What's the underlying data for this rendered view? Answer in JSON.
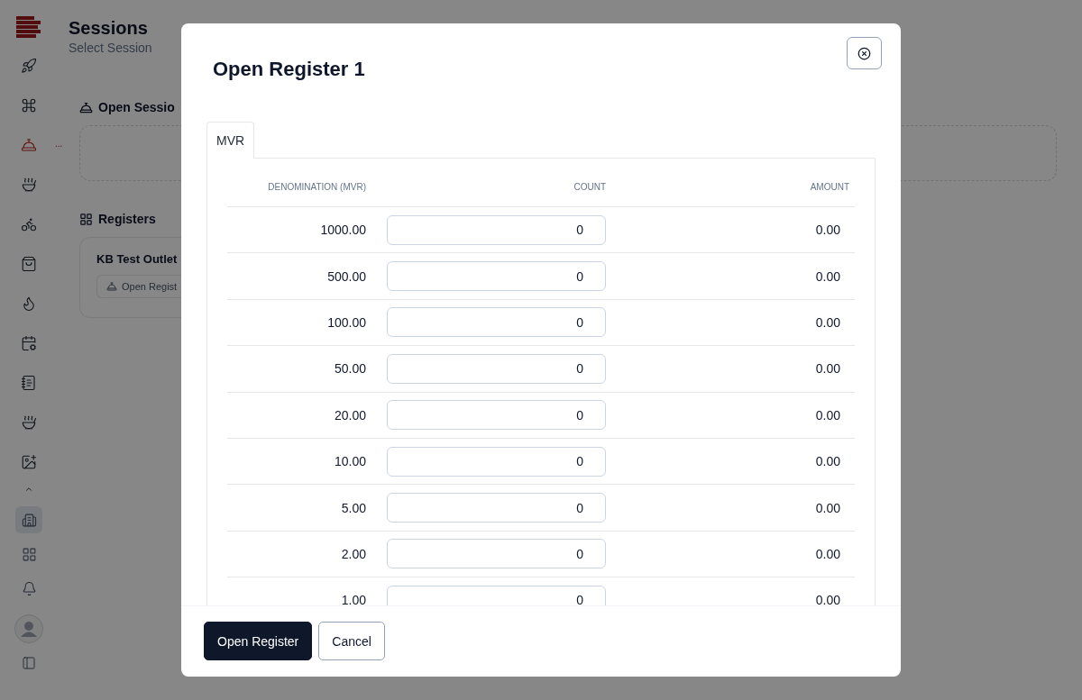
{
  "page": {
    "title": "Sessions",
    "subtitle": "Select Session"
  },
  "sidebar": {
    "nav": [
      {
        "selected": false
      },
      {
        "selected": false
      },
      {
        "selected": true,
        "badge": "..."
      },
      {
        "selected": false
      },
      {
        "selected": false
      },
      {
        "selected": false
      },
      {
        "selected": false
      },
      {
        "selected": false
      },
      {
        "selected": false
      },
      {
        "selected": false
      },
      {
        "selected": false
      }
    ],
    "bottom": [
      {
        "selected": true
      },
      {
        "selected": false
      },
      {
        "selected": false
      }
    ]
  },
  "open_sessions": {
    "heading": "Open Sessio"
  },
  "registers": {
    "heading": "Registers",
    "cards": [
      {
        "name": "KB Test Outlet",
        "button": "Open Regist"
      }
    ]
  },
  "modal": {
    "title": "Open Register 1",
    "tabs": [
      {
        "label": "MVR",
        "selected": true
      }
    ],
    "columns": [
      "DENOMINATION (MVR)",
      "COUNT",
      "AMOUNT"
    ],
    "rows": [
      {
        "denomination": "1000.00",
        "count": "0",
        "amount": "0.00"
      },
      {
        "denomination": "500.00",
        "count": "0",
        "amount": "0.00"
      },
      {
        "denomination": "100.00",
        "count": "0",
        "amount": "0.00"
      },
      {
        "denomination": "50.00",
        "count": "0",
        "amount": "0.00"
      },
      {
        "denomination": "20.00",
        "count": "0",
        "amount": "0.00"
      },
      {
        "denomination": "10.00",
        "count": "0",
        "amount": "0.00"
      },
      {
        "denomination": "5.00",
        "count": "0",
        "amount": "0.00"
      },
      {
        "denomination": "2.00",
        "count": "0",
        "amount": "0.00"
      },
      {
        "denomination": "1.00",
        "count": "0",
        "amount": "0.00"
      }
    ],
    "buttons": [
      {
        "label": "Open Register",
        "kind": "primary"
      },
      {
        "label": "Cancel",
        "kind": "secondary"
      }
    ]
  }
}
